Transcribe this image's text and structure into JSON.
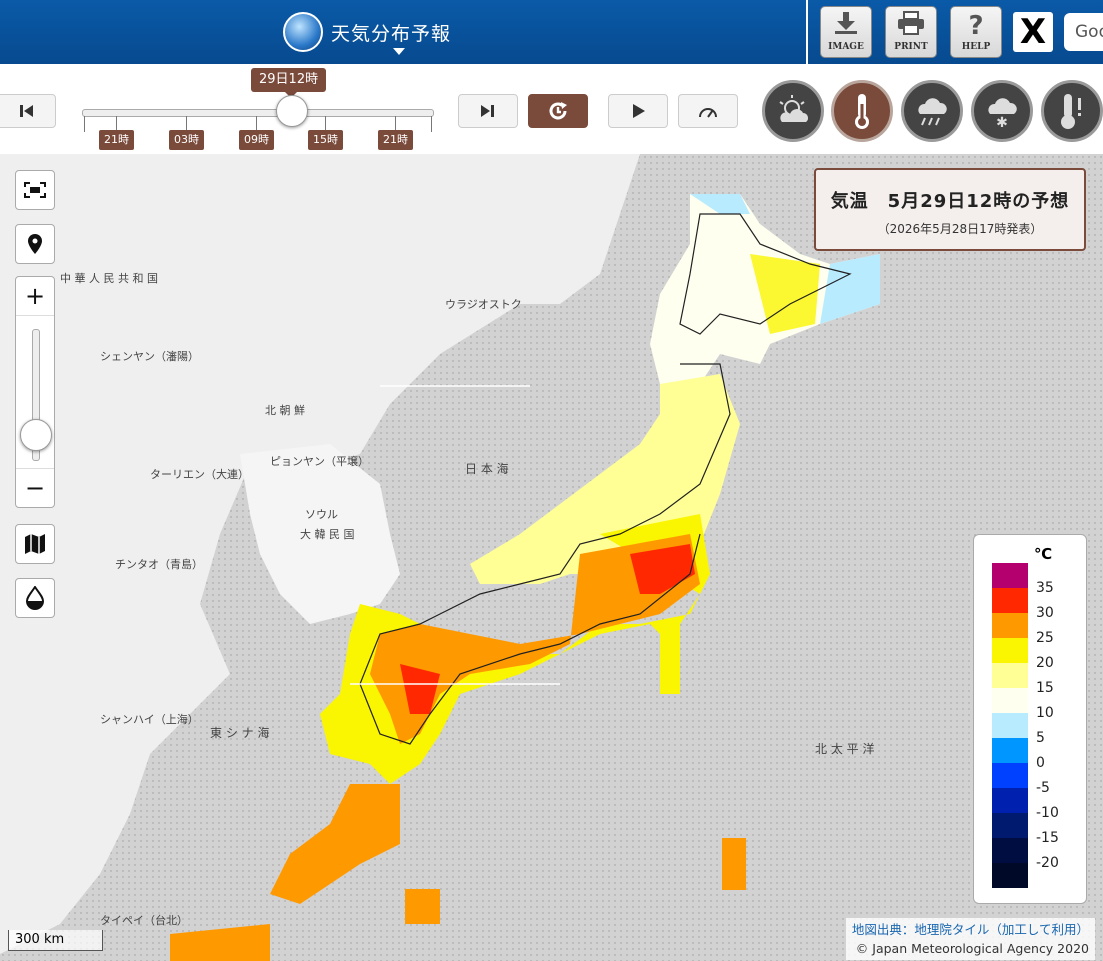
{
  "header": {
    "title": "天気分布予報",
    "buttons": [
      {
        "name": "image",
        "label": "IMAGE"
      },
      {
        "name": "print",
        "label": "PRINT"
      },
      {
        "name": "help",
        "label": "HELP"
      }
    ],
    "x_label": "X",
    "search_text": "Goo"
  },
  "timeline": {
    "current_time": "29日12時",
    "ticks": [
      "21時",
      "03時",
      "09時",
      "15時",
      "21時"
    ]
  },
  "categories": [
    {
      "name": "weather",
      "icon": "sun-cloud-icon",
      "active": false
    },
    {
      "name": "temperature",
      "icon": "thermometer-icon",
      "active": true
    },
    {
      "name": "precipitation",
      "icon": "rain-cloud-icon",
      "active": false
    },
    {
      "name": "snowfall",
      "icon": "snow-cloud-icon",
      "active": false
    },
    {
      "name": "warning",
      "icon": "thermometer-alert-icon",
      "active": false
    }
  ],
  "info": {
    "title": "気温　5月29日12時の予想",
    "issued": "（2026年5月28日17時発表）"
  },
  "legend": {
    "unit": "℃",
    "items": [
      {
        "value": "35",
        "color": "#b4006e"
      },
      {
        "value": "30",
        "color": "#ff2800"
      },
      {
        "value": "25",
        "color": "#ff9900"
      },
      {
        "value": "20",
        "color": "#faf500"
      },
      {
        "value": "15",
        "color": "#ffff96"
      },
      {
        "value": "10",
        "color": "#fffff0"
      },
      {
        "value": "5",
        "color": "#b9ebff"
      },
      {
        "value": "0",
        "color": "#0096ff"
      },
      {
        "value": "-5",
        "color": "#0041ff"
      },
      {
        "value": "-10",
        "color": "#0020b0"
      },
      {
        "value": "-15",
        "color": "#001a70"
      },
      {
        "value": "-20",
        "color": "#000d40"
      }
    ],
    "bottom_color": "#000a28"
  },
  "map": {
    "scale": "300 km",
    "attribution_source": "地図出典：地理院タイル（加工して利用）",
    "copyright": "© Japan Meteorological Agency 2020",
    "labels": {
      "china": "中 華 人 民 共 和 国",
      "north_korea": "北 朝 鮮",
      "south_korea": "大 韓 民 国",
      "sea_of_japan": "日 本 海",
      "east_china_sea": "東 シ ナ 海",
      "pacific": "北 太 平 洋",
      "shenyang": "シェンヤン（瀋陽）",
      "dalian": "ターリエン（大連）",
      "pyongyang": "ピョンヤン（平壌）",
      "seoul": "ソウル",
      "shanghai": "シャンハイ（上海）",
      "qingdao": "チンタオ（青島）",
      "vladivostok": "ウラジオストク",
      "taipei": "タイペイ（台北）"
    }
  }
}
